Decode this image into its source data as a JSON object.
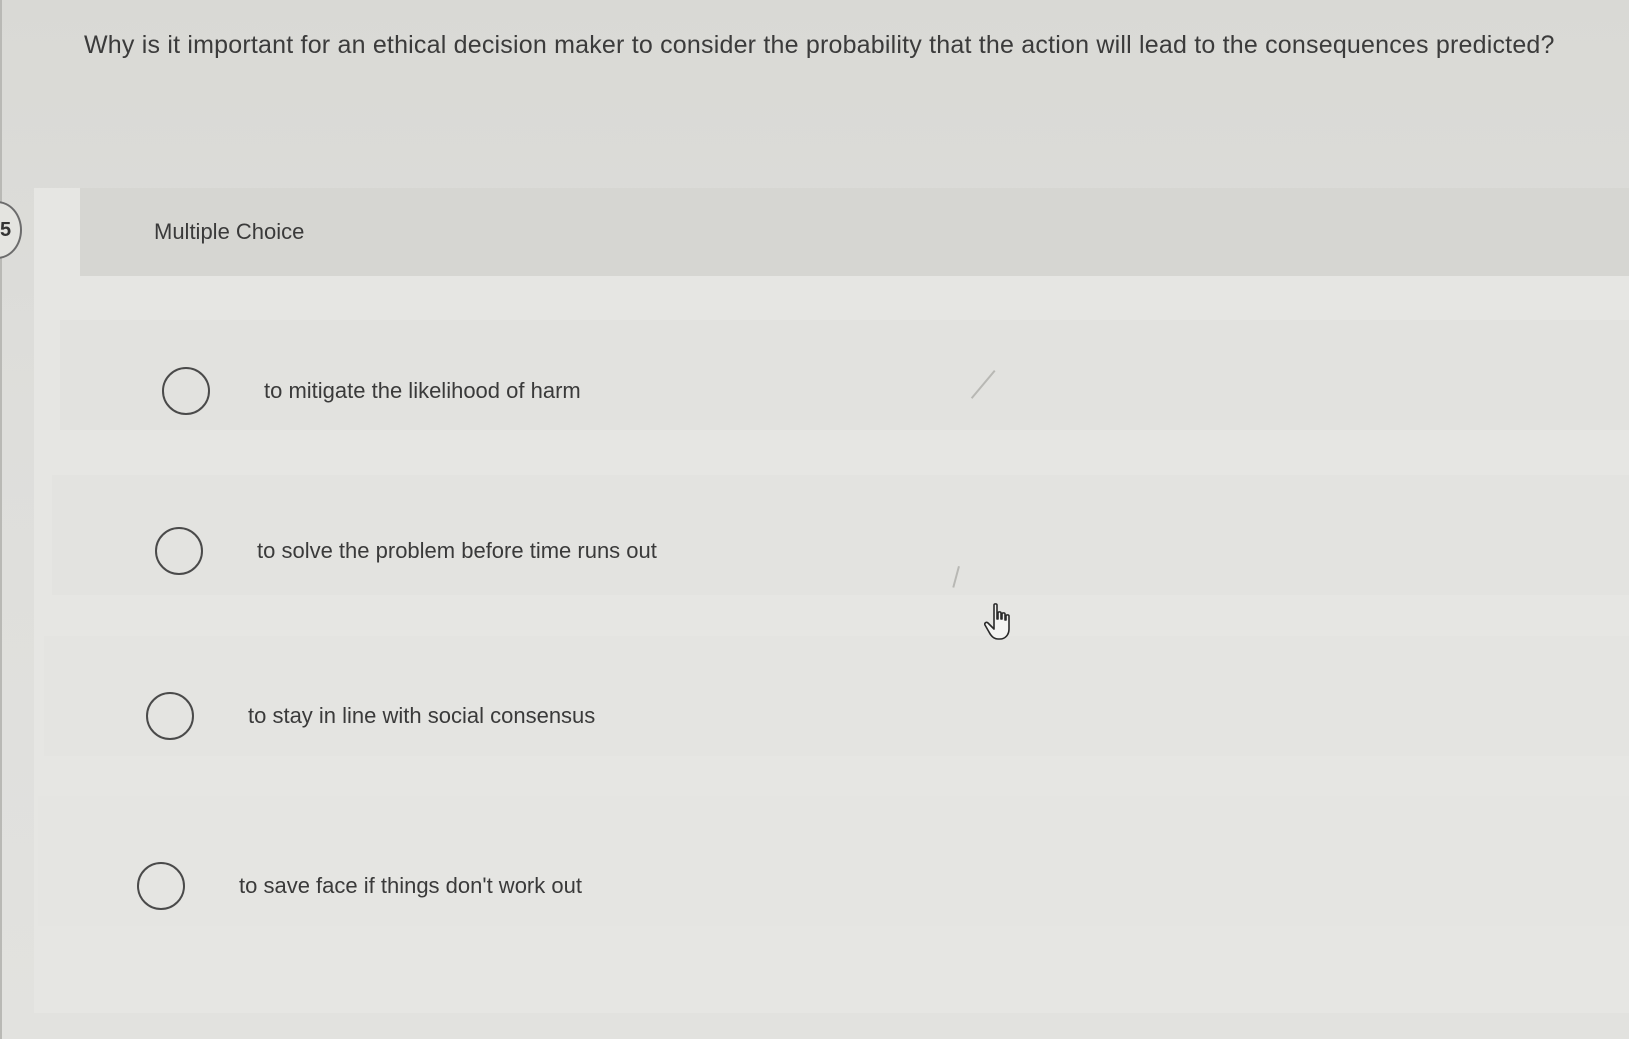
{
  "question": {
    "number": "5",
    "text": "Why is it important for an ethical decision maker to consider the probability that the action will lead to the consequences predicted?"
  },
  "choice_block": {
    "header": "Multiple Choice",
    "options": [
      {
        "label": "to mitigate the likelihood of harm",
        "selected": false
      },
      {
        "label": "to solve the problem before time runs out",
        "selected": false
      },
      {
        "label": "to stay in line with social consensus",
        "selected": false
      },
      {
        "label": "to save face if things don't work out",
        "selected": false
      }
    ]
  },
  "cursor": {
    "icon": "hand-pointer-icon"
  },
  "colors": {
    "background": "#dcdcd8",
    "card": "#e6e6e3",
    "header": "#d6d6d2",
    "text": "#3a3a3a",
    "radio_border": "#4a4a4a"
  }
}
